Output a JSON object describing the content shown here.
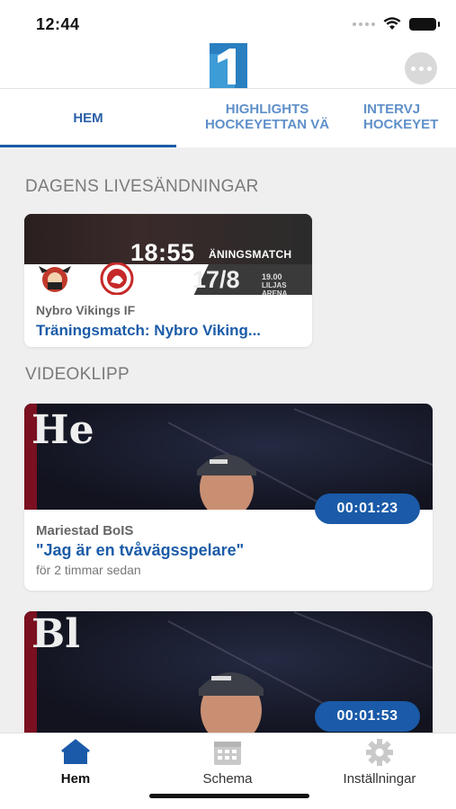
{
  "status_bar": {
    "time": "12:44"
  },
  "header": {
    "logo_icon": "hockeyettan-logo-icon",
    "more_icon": "more-dots-icon"
  },
  "tabs": [
    {
      "label": "HEM",
      "active": true
    },
    {
      "label": "HIGHLIGHTS\nHOCKEYETTAN VÄ",
      "active": false
    },
    {
      "label": "INTERVJ\nHOCKEYET",
      "active": false
    }
  ],
  "live_section": {
    "title": "DAGENS LIVESÄNDNINGAR",
    "card": {
      "thumb_time": "18:55",
      "thumb_tag": "ÄNINGSMATCH",
      "thumb_date": "17/8",
      "thumb_venue_time": "19.00",
      "thumb_venue": "LILJAS ARENA",
      "org": "Nybro Vikings IF",
      "title": "Träningsmatch: Nybro Viking..."
    }
  },
  "video_section": {
    "title": "VIDEOKLIPP",
    "clips": [
      {
        "org": "Mariestad BoIS",
        "title": "\"Jag är en tvåvägsspelare\"",
        "meta": "för 2 timmar sedan",
        "duration": "00:01:23",
        "thumb_letters": "He"
      },
      {
        "thumb_letters": "Bl",
        "duration": "00:01:53"
      }
    ]
  },
  "bottom_nav": [
    {
      "label": "Hem",
      "icon": "home-icon",
      "active": true
    },
    {
      "label": "Schema",
      "icon": "calendar-icon",
      "active": false
    },
    {
      "label": "Inställningar",
      "icon": "gear-icon",
      "active": false
    }
  ],
  "colors": {
    "accent": "#1a5aa8",
    "tab_inactive": "#5f90c9",
    "background": "#efeff0"
  }
}
